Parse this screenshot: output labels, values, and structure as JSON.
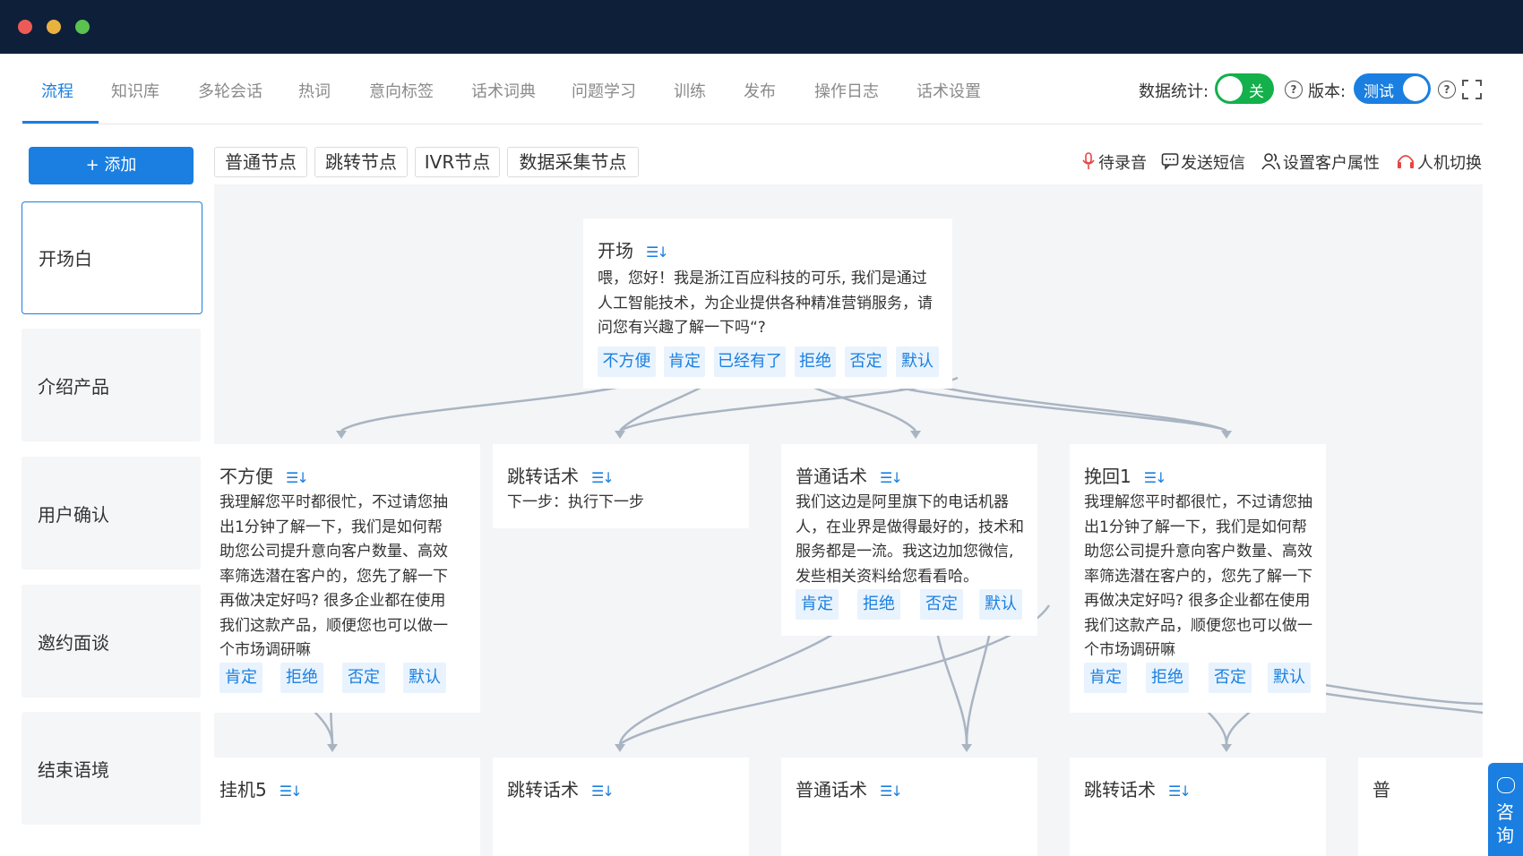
{
  "nav": {
    "tabs": [
      "流程",
      "知识库",
      "多轮会话",
      "热词",
      "意向标签",
      "话术词典",
      "问题学习",
      "训练",
      "发布",
      "操作日志",
      "话术设置"
    ],
    "stats_label": "数据统计:",
    "stats_toggle": "关",
    "version_label": "版本:",
    "version_toggle": "测试"
  },
  "sidebar": {
    "add_label": "+ 添加",
    "stages": [
      "开场白",
      "介绍产品",
      "用户确认",
      "邀约面谈",
      "结束语境"
    ]
  },
  "toolbar": {
    "node_types": [
      "普通节点",
      "跳转节点",
      "IVR节点",
      "数据采集节点"
    ],
    "actions": [
      "待录音",
      "发送短信",
      "设置客户属性",
      "人机切换"
    ]
  },
  "flow": {
    "root": {
      "title": "开场",
      "lines": [
        "喂，您好！我是浙江百应科技的可乐, 我们是通过",
        "人工智能技术，为企业提供各种精准营销服务，请",
        "问您有兴趣了解一下吗“?"
      ],
      "tags": [
        "不方便",
        "肯定",
        "已经有了",
        "拒绝",
        "否定",
        "默认"
      ]
    },
    "row1": [
      {
        "title": "不方便",
        "lines": [
          "我理解您平时都很忙，不过请您抽",
          "出1分钟了解一下，我们是如何帮",
          "助您公司提升意向客户数量、高效",
          "率筛选潜在客户的，您先了解一下",
          "再做决定好吗? 很多企业都在使用",
          "我们这款产品，顺便您也可以做一",
          "个市场调研嘛"
        ],
        "tags": [
          "肯定",
          "拒绝",
          "否定",
          "默认"
        ]
      },
      {
        "title": "跳转话术",
        "lines": [
          "下一步：执行下一步"
        ],
        "tags": []
      },
      {
        "title": "普通话术",
        "lines": [
          "我们这边是阿里旗下的电话机器",
          "人，在业界是做得最好的，技术和",
          "服务都是一流。我这边加您微信,",
          "发些相关资料给您看看哈。"
        ],
        "tags": [
          "肯定",
          "拒绝",
          "否定",
          "默认"
        ]
      },
      {
        "title": "挽回1",
        "lines": [
          "我理解您平时都很忙，不过请您抽",
          "出1分钟了解一下，我们是如何帮",
          "助您公司提升意向客户数量、高效",
          "率筛选潜在客户的，您先了解一下",
          "再做决定好吗? 很多企业都在使用",
          "我们这款产品，顺便您也可以做一",
          "个市场调研嘛"
        ],
        "tags": [
          "肯定",
          "拒绝",
          "否定",
          "默认"
        ]
      }
    ],
    "row2": [
      {
        "title": "挂机5"
      },
      {
        "title": "跳转话术"
      },
      {
        "title": "普通话术"
      },
      {
        "title": "跳转话术"
      },
      {
        "title": "普"
      }
    ]
  },
  "consult": {
    "label": "咨询"
  },
  "colors": {
    "accent": "#1a7fe0",
    "titlebar": "#0e1f3a",
    "toggle_green": "#13b04b",
    "tag_bg": "#e9f3fd",
    "wire": "#a9b4c2"
  }
}
